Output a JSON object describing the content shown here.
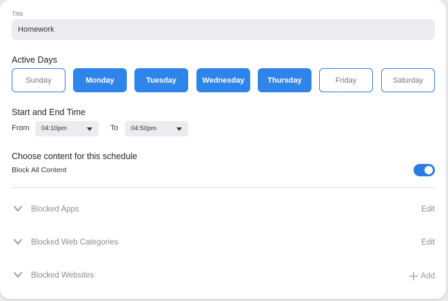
{
  "form": {
    "title_label": "Title",
    "title_value": "Homework"
  },
  "active_days": {
    "heading": "Active Days",
    "days": [
      {
        "label": "Sunday",
        "selected": false
      },
      {
        "label": "Monday",
        "selected": true
      },
      {
        "label": "Tuesday",
        "selected": true
      },
      {
        "label": "Wednesday",
        "selected": true
      },
      {
        "label": "Thursday",
        "selected": true
      },
      {
        "label": "Friday",
        "selected": false
      },
      {
        "label": "Saturday",
        "selected": false
      }
    ]
  },
  "time": {
    "heading": "Start and End Time",
    "from_label": "From",
    "from_value": "04:10pm",
    "to_label": "To",
    "to_value": "04:50pm"
  },
  "content": {
    "heading": "Choose content for this schedule",
    "block_all_label": "Block All Content",
    "block_all_enabled": true
  },
  "sections": [
    {
      "label": "Blocked Apps",
      "action": "Edit"
    },
    {
      "label": "Blocked Web Categories",
      "action": "Edit"
    },
    {
      "label": "Blocked Websites",
      "action": "Add"
    }
  ],
  "colors": {
    "accent": "#2f84ea",
    "muted_text": "#8c8c8c",
    "input_bg": "#ececf0"
  },
  "icons": {
    "chevron": "chevron-down-icon",
    "add": "plus-icon"
  }
}
